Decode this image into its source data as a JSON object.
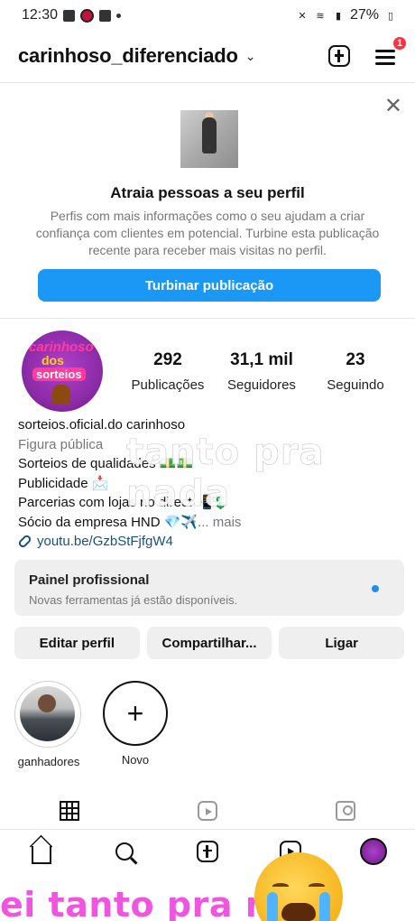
{
  "status_bar": {
    "time": "12:30",
    "battery": "27%"
  },
  "header": {
    "username": "carinhoso_diferenciado",
    "notification_count": "1"
  },
  "promo": {
    "title": "Atraia pessoas a seu perfil",
    "text": "Perfis com mais informações como o seu ajudam a criar confiança com clientes em potencial. Turbine esta publicação recente para receber mais visitas no perfil.",
    "button_label": "Turbinar publicação"
  },
  "profile": {
    "avatar_text": [
      "carinhoso",
      "dos",
      "sorteios"
    ],
    "stats": [
      {
        "value": "292",
        "label": "Publicações"
      },
      {
        "value": "31,1 mil",
        "label": "Seguidores"
      },
      {
        "value": "23",
        "label": "Seguindo"
      }
    ],
    "bio": {
      "name": "sorteios.oficial.do carinhoso",
      "category": "Figura pública",
      "line1": "Sorteios de qualidades 💵💵",
      "line2": "Publicidade 📩",
      "line3": "Parcerias com lojas no direct 📲💲",
      "line4": "Sócio da empresa HND 💎✈️",
      "more": "... mais",
      "link": "youtu.be/GzbStFjfgW4"
    },
    "overlay_text": "tanto pra nada"
  },
  "panel": {
    "title": "Painel profissional",
    "subtitle": "Novas ferramentas já estão disponíveis."
  },
  "actions": {
    "edit": "Editar perfil",
    "share": "Compartilhar...",
    "call": "Ligar"
  },
  "highlights": [
    {
      "label": "ganhadores"
    },
    {
      "label": "Novo"
    }
  ],
  "caption": {
    "text": "ei tanto pra na"
  },
  "colors": {
    "accent": "#1b98f5",
    "badge": "#ff3040",
    "caption": "#f055e0"
  },
  "icons": [
    "grid-icon",
    "reels-icon",
    "tagged-icon",
    "home-icon",
    "search-icon",
    "create-icon",
    "reels-nav-icon",
    "profile-avatar"
  ]
}
